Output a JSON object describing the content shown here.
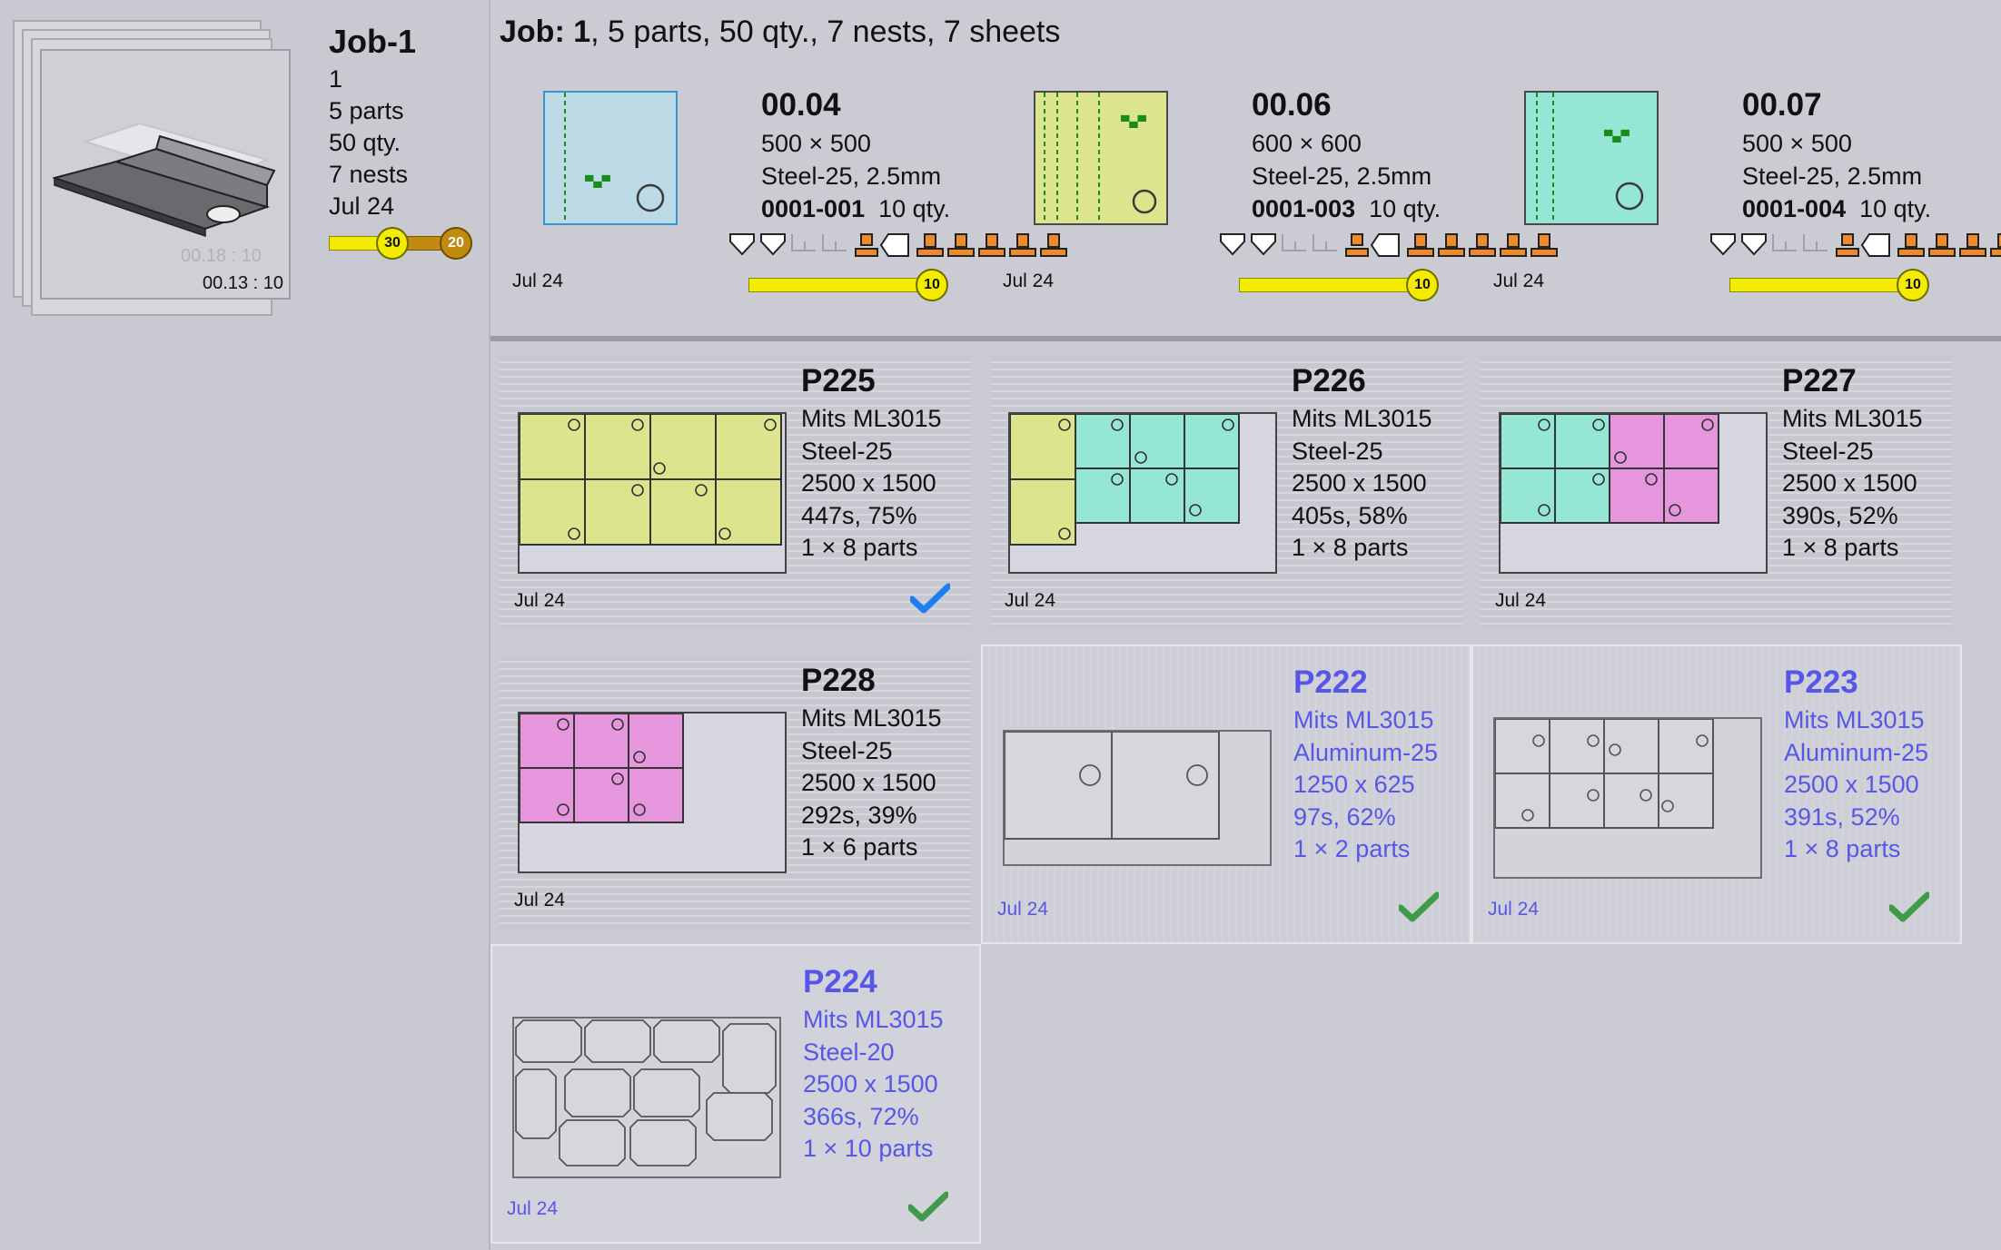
{
  "job": {
    "title": "Job-1",
    "number": "1",
    "parts": "5 parts",
    "qty": "50 qty.",
    "nests": "7 nests",
    "date": "Jul 24",
    "ghost_time": "00.18 : 10",
    "front_time": "00.13 : 10",
    "progress_yellow": "30",
    "progress_gold": "20"
  },
  "header": {
    "label": "Job:",
    "number": "1",
    "rest": ", 5 parts, 50 qty., 7 nests, 7 sheets"
  },
  "nests": [
    {
      "code": "00.04",
      "size": "500 × 500",
      "material": "Steel-25, 2.5mm",
      "part": "0001-001",
      "qty": "10 qty.",
      "date": "Jul 24",
      "count": "10",
      "color": "#bcdbe6",
      "border": "#3c93c8"
    },
    {
      "code": "00.06",
      "size": "600 × 600",
      "material": "Steel-25, 2.5mm",
      "part": "0001-003",
      "qty": "10 qty.",
      "date": "Jul 24",
      "count": "10",
      "color": "#dce48e",
      "border": "#4a4a4a"
    },
    {
      "code": "00.07",
      "size": "500 × 500",
      "material": "Steel-25, 2.5mm",
      "part": "0001-004",
      "qty": "10 qty.",
      "date": "Jul 24",
      "count": "10",
      "color": "#96e6d6",
      "border": "#4a4a4a"
    }
  ],
  "programs": [
    {
      "name": "P225",
      "machine": "Mits ML3015",
      "material": "Steel-25",
      "size": "2500 x 1500",
      "stats": "447s, 75%",
      "parts": "1 × 8 parts",
      "date": "Jul 24",
      "check": "blue"
    },
    {
      "name": "P226",
      "machine": "Mits ML3015",
      "material": "Steel-25",
      "size": "2500 x 1500",
      "stats": "405s, 58%",
      "parts": "1 × 8 parts",
      "date": "Jul 24",
      "check": "none"
    },
    {
      "name": "P227",
      "machine": "Mits ML3015",
      "material": "Steel-25",
      "size": "2500 x 1500",
      "stats": "390s, 52%",
      "parts": "1 × 8 parts",
      "date": "Jul 24",
      "check": "none"
    },
    {
      "name": "P228",
      "machine": "Mits ML3015",
      "material": "Steel-25",
      "size": "2500 x 1500",
      "stats": "292s, 39%",
      "parts": "1 × 6 parts",
      "date": "Jul 24",
      "check": "none"
    },
    {
      "name": "P222",
      "machine": "Mits ML3015",
      "material": "Aluminum-25",
      "size": "1250 x 625",
      "stats": "97s, 62%",
      "parts": "1 × 2 parts",
      "date": "Jul 24",
      "check": "green"
    },
    {
      "name": "P223",
      "machine": "Mits ML3015",
      "material": "Aluminum-25",
      "size": "2500 x 1500",
      "stats": "391s, 52%",
      "parts": "1 × 8 parts",
      "date": "Jul 24",
      "check": "green"
    },
    {
      "name": "P224",
      "machine": "Mits ML3015",
      "material": "Steel-20",
      "size": "2500 x 1500",
      "stats": "366s, 72%",
      "parts": "1 × 10 parts",
      "date": "Jul 24",
      "check": "green"
    }
  ],
  "colors": {
    "yellow_part": "#dce48e",
    "teal_part": "#96e6d6",
    "pink_part": "#e596dc",
    "done_text": "#5656e8",
    "check_blue": "#1e7ef0",
    "check_green": "#3f9a4a",
    "progress": "#f4ec00"
  }
}
